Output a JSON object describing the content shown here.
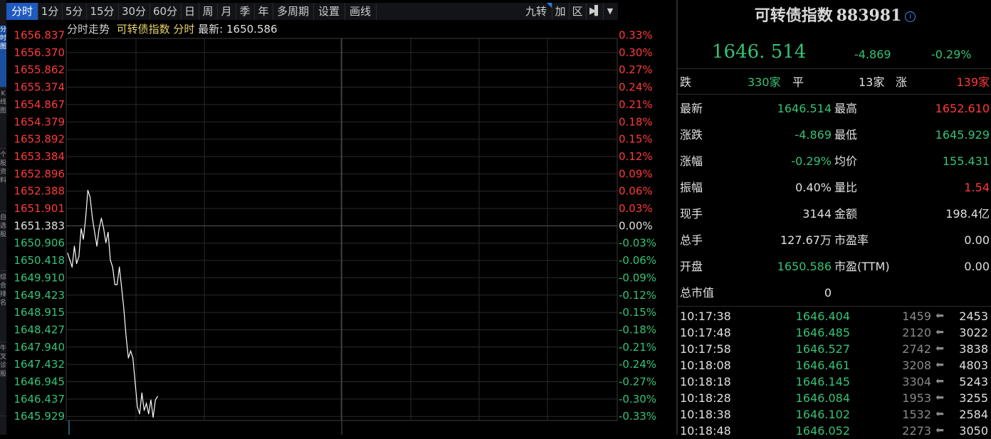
{
  "side_tabs": [
    {
      "label": "分时图",
      "active": true
    },
    {
      "label": "K线图",
      "active": false
    },
    {
      "label": "个股资料",
      "active": false
    },
    {
      "label": "自选股",
      "active": false
    },
    {
      "label": "综合排名",
      "active": false
    },
    {
      "label": "牛叉诊股",
      "active": false
    }
  ],
  "toolbar": {
    "buttons": [
      "分时",
      "1分",
      "5分",
      "15分",
      "30分",
      "60分",
      "日",
      "周",
      "月",
      "季",
      "年",
      "多周期",
      "设置",
      "画线"
    ],
    "active": "分时",
    "right_buttons": [
      "九转",
      "加",
      "区"
    ],
    "arrow_icon": "exit-arrow-icon",
    "dropdown_icon": "chevron-down-icon"
  },
  "chart_header": {
    "label": "分时走势",
    "name": "可转债指数",
    "period": "分时",
    "latest_label": "最新:",
    "latest_value": "1650.586"
  },
  "chart_data": {
    "type": "line",
    "y_labels_left": [
      "1656.837",
      "1656.370",
      "1655.862",
      "1655.374",
      "1654.867",
      "1654.379",
      "1653.892",
      "1653.384",
      "1652.896",
      "1652.388",
      "1651.901",
      "1651.383",
      "1650.906",
      "1650.418",
      "1649.910",
      "1649.423",
      "1648.915",
      "1648.427",
      "1647.940",
      "1647.432",
      "1646.945",
      "1646.437",
      "1645.929"
    ],
    "y_labels_right": [
      "0.33%",
      "0.30%",
      "0.27%",
      "0.24%",
      "0.21%",
      "0.18%",
      "0.15%",
      "0.12%",
      "0.09%",
      "0.06%",
      "0.03%",
      "0.00%",
      "-0.03%",
      "-0.06%",
      "-0.09%",
      "-0.12%",
      "-0.15%",
      "-0.18%",
      "-0.21%",
      "-0.24%",
      "-0.27%",
      "-0.30%",
      "-0.33%"
    ],
    "ylim": [
      1645.929,
      1656.837
    ],
    "prev_close": 1651.383,
    "total_minutes": 240,
    "series": [
      {
        "values": [
          1650.6,
          1650.4,
          1650.2,
          1650.8,
          1650.3,
          1650.5,
          1651.3,
          1651.0,
          1651.6,
          1652.4,
          1652.2,
          1651.6,
          1651.2,
          1650.8,
          1651.3,
          1651.6,
          1651.3,
          1650.9,
          1651.2,
          1650.4,
          1650.2,
          1649.7,
          1649.7,
          1650.2,
          1649.6,
          1649.0,
          1648.2,
          1647.6,
          1647.8,
          1647.6,
          1646.9,
          1646.2,
          1646.0,
          1646.6,
          1646.1,
          1646.3,
          1646.0,
          1646.4,
          1645.9,
          1646.4,
          1646.5
        ]
      }
    ],
    "colors": {
      "line": "#ffffff",
      "up": "#ff3a3a",
      "down": "#35c276",
      "flat": "#e0e0e0",
      "grid": "#2a2a2a"
    }
  },
  "quote": {
    "title": "可转债指数",
    "code": "883981",
    "price": "1646. 514",
    "change": "-4.869",
    "change_pct": "-0.29%",
    "breadth": {
      "down_label": "跌",
      "down_value": "330家",
      "flat_label": "平",
      "flat_value": "13家",
      "up_label": "涨",
      "up_value": "139家"
    },
    "stats": [
      {
        "l1": "最新",
        "v1": "1646.514",
        "c1": "green",
        "l2": "最高",
        "v2": "1652.610",
        "c2": "red"
      },
      {
        "l1": "涨跌",
        "v1": "-4.869",
        "c1": "green",
        "l2": "最低",
        "v2": "1645.929",
        "c2": "green"
      },
      {
        "l1": "涨幅",
        "v1": "-0.29%",
        "c1": "green",
        "l2": "均价",
        "v2": "155.431",
        "c2": "green"
      },
      {
        "l1": "振幅",
        "v1": "0.40%",
        "c1": "white",
        "l2": "量比",
        "v2": "1.54",
        "c2": "red"
      },
      {
        "l1": "现手",
        "v1": "3144",
        "c1": "white",
        "l2": "金额",
        "v2": "198.4亿",
        "c2": "white"
      },
      {
        "l1": "总手",
        "v1": "127.67万",
        "c1": "white",
        "l2": "市盈率",
        "v2": "0.00",
        "c2": "white"
      },
      {
        "l1": "开盘",
        "v1": "1650.586",
        "c1": "green",
        "l2": "市盈(TTM)",
        "v2": "0.00",
        "c2": "white"
      },
      {
        "l1": "总市值",
        "v1": "0",
        "c1": "white",
        "l2": "",
        "v2": "",
        "c2": "white"
      }
    ],
    "ticks": [
      {
        "time": "10:17:38",
        "price": "1646.404",
        "vol": "1459",
        "total": "2453"
      },
      {
        "time": "10:17:48",
        "price": "1646.485",
        "vol": "2120",
        "total": "3022"
      },
      {
        "time": "10:17:58",
        "price": "1646.527",
        "vol": "2742",
        "total": "3838"
      },
      {
        "time": "10:18:08",
        "price": "1646.461",
        "vol": "3208",
        "total": "4803"
      },
      {
        "time": "10:18:18",
        "price": "1646.145",
        "vol": "3304",
        "total": "5243"
      },
      {
        "time": "10:18:28",
        "price": "1646.084",
        "vol": "1953",
        "total": "3255"
      },
      {
        "time": "10:18:38",
        "price": "1646.102",
        "vol": "1532",
        "total": "2584"
      },
      {
        "time": "10:18:48",
        "price": "1646.052",
        "vol": "2273",
        "total": "3050"
      }
    ]
  }
}
